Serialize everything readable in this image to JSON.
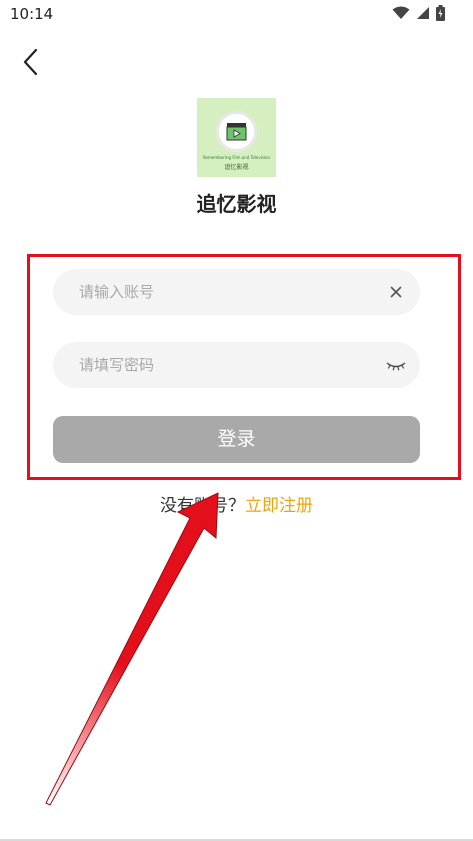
{
  "status_bar": {
    "time": "10:14"
  },
  "app": {
    "name": "追忆影视",
    "logo_small_text": "Remembering Film and Television",
    "logo_name_text": "追忆影视",
    "logo_bg": "#d6efc1"
  },
  "form": {
    "account_placeholder": "请输入账号",
    "password_placeholder": "请填写密码",
    "login_label": "登录",
    "no_account_text": "没有账号？",
    "register_link": "立即注册"
  },
  "colors": {
    "button_gray": "#a9a9a9",
    "link_orange": "#f4a20b",
    "annotation_red": "#e3101b"
  }
}
